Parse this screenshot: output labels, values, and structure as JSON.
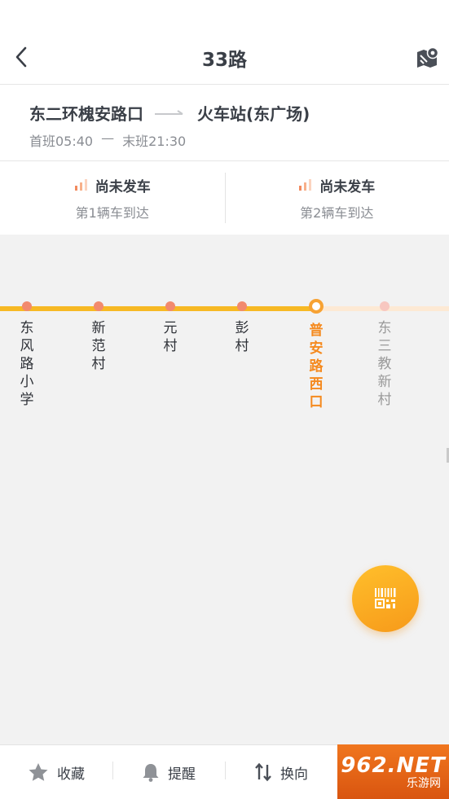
{
  "nav": {
    "title": "33路",
    "back_icon": "chevron-left-icon",
    "map_icon": "map-pin-icon"
  },
  "route": {
    "from": "东二环槐安路口",
    "to": "火车站(东广场)",
    "first_bus": "首班05:40",
    "separator": "—",
    "last_bus": "末班21:30"
  },
  "arrivals": [
    {
      "status": "尚未发车",
      "sub": "第1辆车到达",
      "icon": "signal-icon"
    },
    {
      "status": "尚未发车",
      "sub": "第2辆车到达",
      "icon": "signal-icon"
    }
  ],
  "stations": [
    {
      "name": "东风路小学",
      "state": "passed"
    },
    {
      "name": "新范村",
      "state": "passed"
    },
    {
      "name": "元村",
      "state": "passed"
    },
    {
      "name": "彭村",
      "state": "passed"
    },
    {
      "name": "普安路西口",
      "state": "current"
    },
    {
      "name": "东三教新村",
      "state": "future"
    }
  ],
  "fab": {
    "icon": "barcode-scan-icon"
  },
  "bottom_tabs": [
    {
      "label": "收藏",
      "icon": "star-icon"
    },
    {
      "label": "提醒",
      "icon": "bell-icon"
    },
    {
      "label": "换向",
      "icon": "swap-vertical-icon"
    }
  ],
  "watermark": {
    "logo": "962.NET",
    "sub": "乐游网"
  },
  "colors": {
    "accent": "#f7a233",
    "track_done": "#f7b924",
    "track_todo": "#fde9d4",
    "station_dot": "#f28a6e",
    "current_station_text": "#f58a1f",
    "map_bg": "#f2f2f2"
  }
}
